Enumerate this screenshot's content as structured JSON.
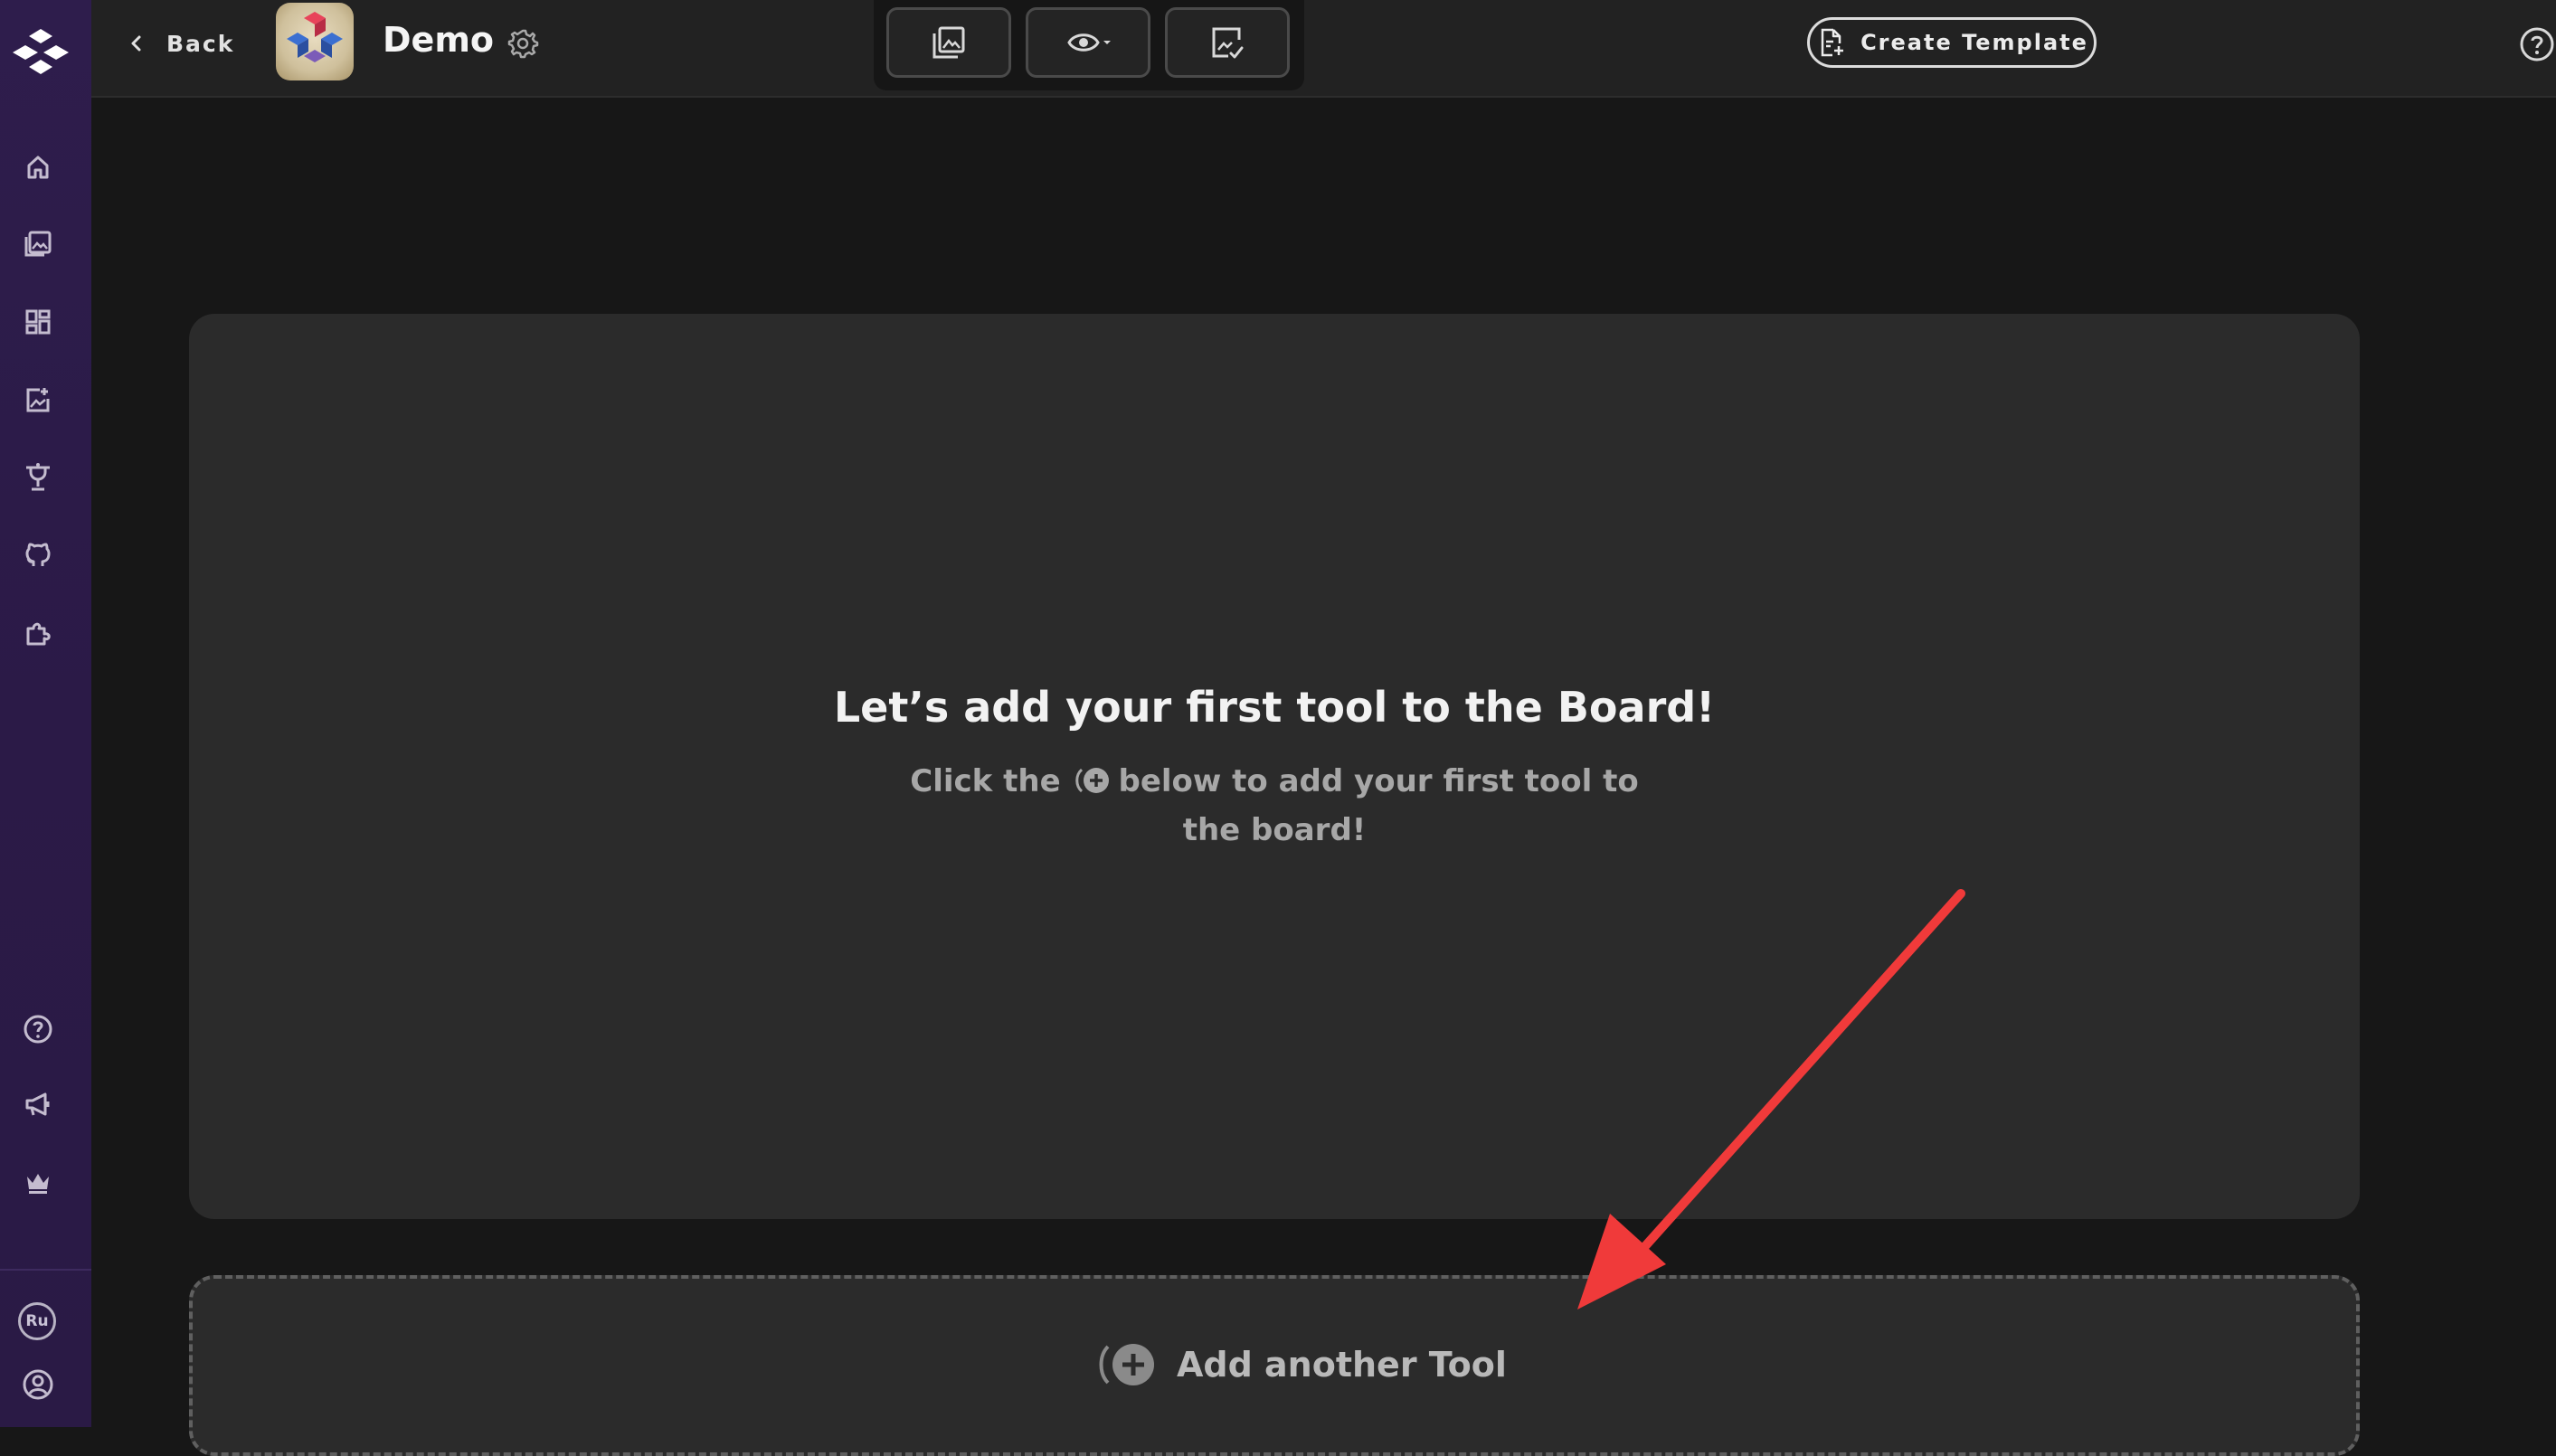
{
  "header": {
    "back_label": "Back",
    "board_title": "Demo",
    "create_template_label": "Create Template"
  },
  "toolbar": {
    "buttons": [
      {
        "icon": "gallery-icon"
      },
      {
        "icon": "eye-icon",
        "has_dropdown": true
      },
      {
        "icon": "screen-check-icon"
      }
    ]
  },
  "sidebar": {
    "nav_icons": [
      "home-icon",
      "gallery-icon",
      "dashboard-icon",
      "image-add-icon",
      "trophy-icon",
      "github-icon",
      "puzzle-icon"
    ],
    "bottom_icons": [
      "help-icon",
      "megaphone-icon",
      "crown-icon"
    ],
    "language_badge": "Ru",
    "profile_icon": "user-circle-icon"
  },
  "empty_state": {
    "title": "Let’s add your first tool to the Board!",
    "subtitle_before": "Click the",
    "subtitle_after": "below to add your first tool to the board!"
  },
  "add_tool": {
    "label": "Add another Tool"
  },
  "colors": {
    "sidebar_bg": "#2e1d4c",
    "page_bg": "#171717",
    "card_bg": "#2b2b2b",
    "annotation_arrow": "#f03a3a"
  }
}
